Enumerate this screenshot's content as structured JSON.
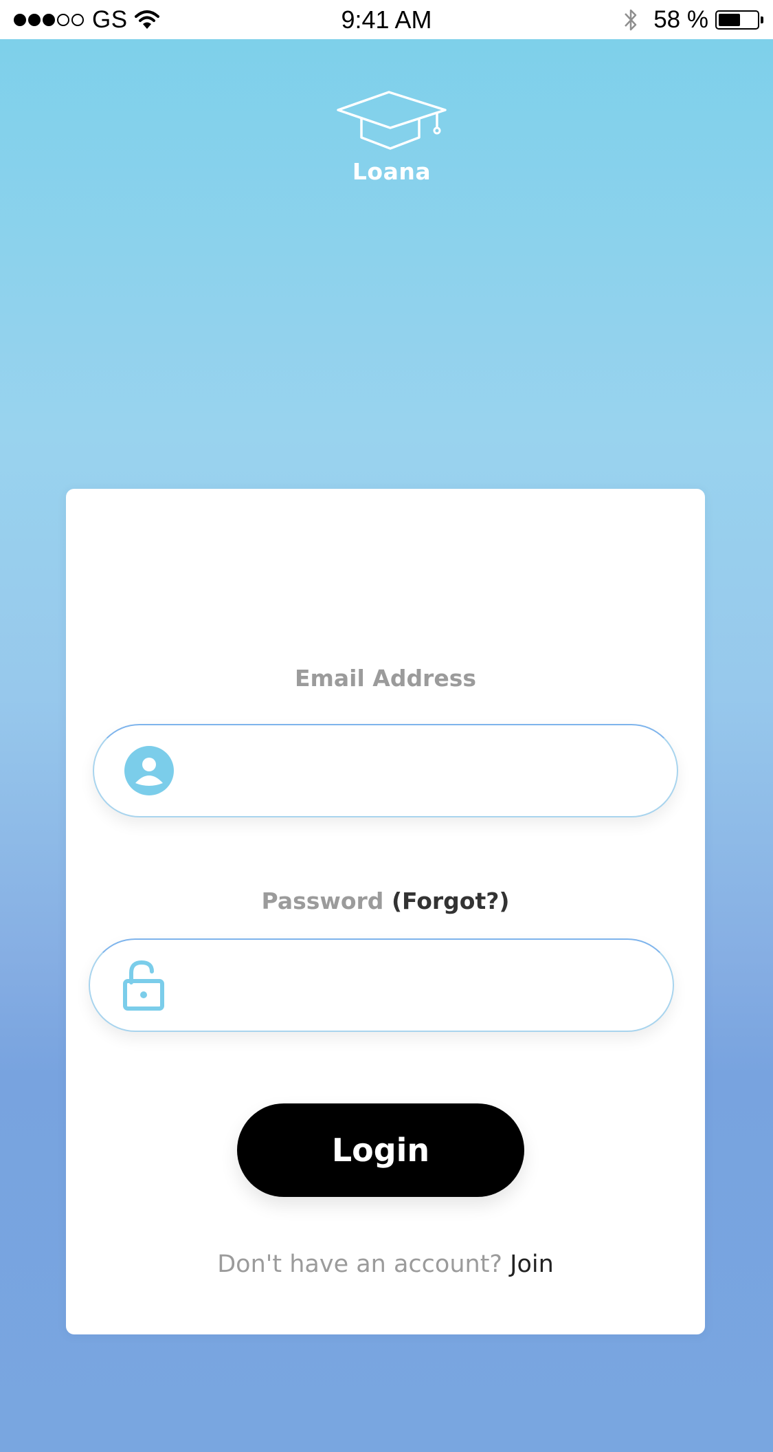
{
  "status_bar": {
    "carrier": "GS",
    "signal_filled": 3,
    "signal_total": 5,
    "time": "9:41 AM",
    "battery_percent_text": "58 %",
    "battery_level": 0.58
  },
  "app": {
    "name": "Loana",
    "logo_icon": "graduation-cap-icon"
  },
  "login_form": {
    "email_label": "Email Address",
    "email_value": "",
    "email_icon": "user-icon",
    "password_label": "Password",
    "forgot_label": "(Forgot?)",
    "password_value": "",
    "password_icon": "unlock-icon",
    "login_button": "Login",
    "no_account_text": "Don't have an account?",
    "join_link": "Join"
  },
  "colors": {
    "accent": "#7bcdea",
    "gradient_top": "#7bd0ea",
    "gradient_bottom": "#79a6e0",
    "button": "#000000",
    "label_gray": "#9b9b9b"
  }
}
